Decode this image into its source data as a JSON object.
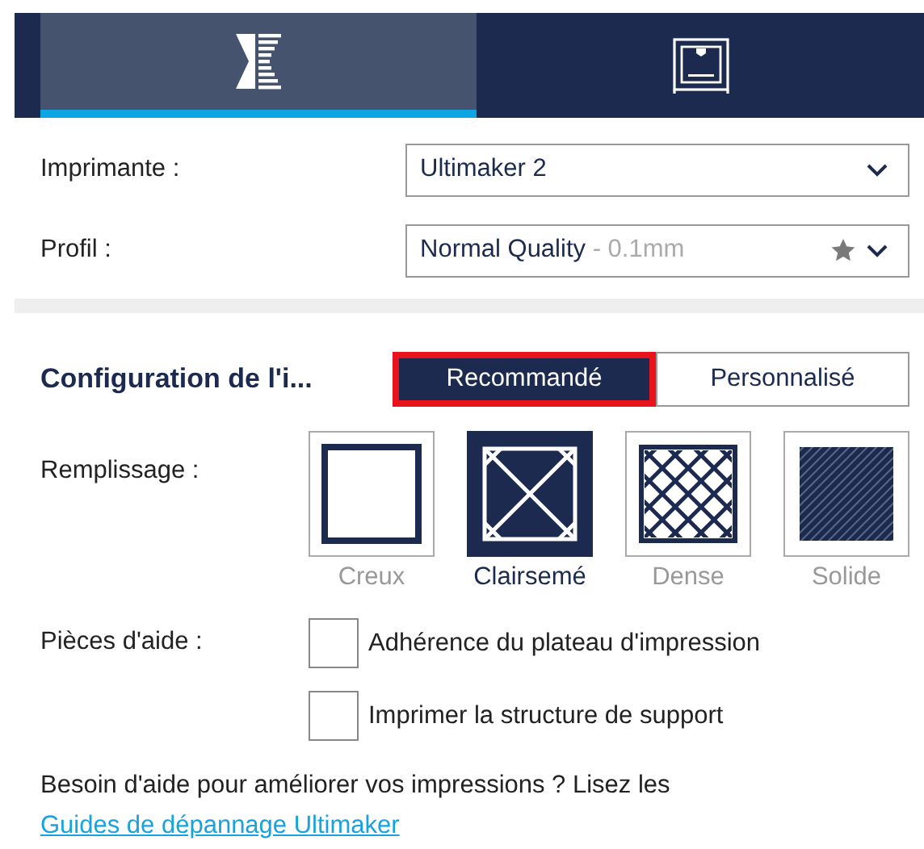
{
  "tabs": [
    {
      "kind": "layers",
      "selected": true
    },
    {
      "kind": "printer",
      "selected": false
    }
  ],
  "printer": {
    "label": "Imprimante :",
    "value": "Ultimaker 2"
  },
  "profile": {
    "label": "Profil :",
    "value": "Normal Quality",
    "detail": "- 0.1mm"
  },
  "configuration": {
    "title": "Configuration de l'i...",
    "modes": [
      {
        "label": "Recommandé",
        "selected": true,
        "highlighted": true
      },
      {
        "label": "Personnalisé",
        "selected": false,
        "highlighted": false
      }
    ]
  },
  "infill": {
    "label": "Remplissage :",
    "options": [
      {
        "kind": "hollow",
        "label": "Creux",
        "selected": false
      },
      {
        "kind": "sparse",
        "label": "Clairsemé",
        "selected": true
      },
      {
        "kind": "dense",
        "label": "Dense",
        "selected": false
      },
      {
        "kind": "solid",
        "label": "Solide",
        "selected": false
      }
    ]
  },
  "helpers": {
    "label": "Pièces d'aide :",
    "options": [
      {
        "label": "Adhérence du plateau d'impression",
        "checked": false
      },
      {
        "label": "Imprimer la structure de support",
        "checked": false
      }
    ]
  },
  "help": {
    "text": "Besoin d'aide pour améliorer vos impressions ? Lisez les",
    "link": "Guides de dépannage Ultimaker"
  }
}
